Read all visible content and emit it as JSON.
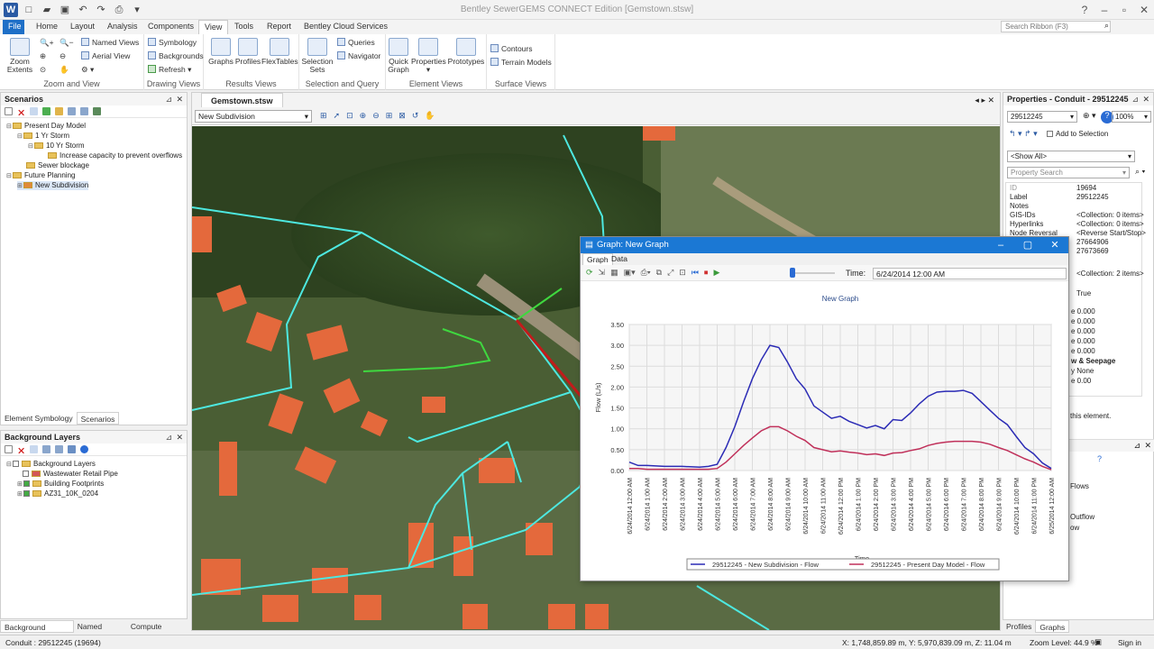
{
  "app": {
    "title": "Bentley SewerGEMS CONNECT Edition [Gemstown.stsw]",
    "search_ribbon_placeholder": "Search Ribbon (F3)"
  },
  "tabs": [
    "File",
    "Home",
    "Layout",
    "Analysis",
    "Components",
    "View",
    "Tools",
    "Report",
    "Bentley Cloud Services"
  ],
  "active_tab": "View",
  "ribbon": {
    "zoom_group": {
      "label": "Zoom and View",
      "zoom_extents": "Zoom Extents",
      "named_views": "Named Views",
      "aerial_view": "Aerial View"
    },
    "drawing_group": {
      "label": "Drawing Views",
      "symbology": "Symbology",
      "backgrounds": "Backgrounds",
      "refresh": "Refresh"
    },
    "results_group": {
      "label": "Results Views",
      "graphs": "Graphs",
      "profiles": "Profiles",
      "flextables": "FlexTables"
    },
    "selection_group": {
      "label": "Selection and Query",
      "selection_sets": "Selection Sets",
      "queries": "Queries",
      "navigator": "Navigator"
    },
    "element_group": {
      "label": "Element Views",
      "quick_graph": "Quick Graph",
      "properties": "Properties",
      "prototypes": "Prototypes"
    },
    "surface_group": {
      "label": "Surface Views",
      "contours": "Contours",
      "terrain_models": "Terrain Models"
    }
  },
  "scenarios_panel": {
    "title": "Scenarios",
    "items": [
      {
        "label": "Present Day Model",
        "level": 0
      },
      {
        "label": "1 Yr Storm",
        "level": 1
      },
      {
        "label": "10 Yr Storm",
        "level": 2
      },
      {
        "label": "Increase capacity to prevent overflows",
        "level": 3
      },
      {
        "label": "Sewer blockage",
        "level": 1
      },
      {
        "label": "Future Planning",
        "level": 0
      },
      {
        "label": "New Subdivision",
        "level": 1
      }
    ],
    "tabs": [
      "Element Symbology",
      "Scenarios"
    ]
  },
  "background_panel": {
    "title": "Background Layers",
    "items": [
      {
        "label": "Background Layers",
        "level": 0
      },
      {
        "label": "Wastewater Retail Pipe",
        "level": 1
      },
      {
        "label": "Building Footprints",
        "level": 1
      },
      {
        "label": "AZ31_10K_0204",
        "level": 1
      }
    ],
    "tabs": [
      "Background Layers",
      "Named Views",
      "Compute Center"
    ]
  },
  "document": {
    "tab": "Gemstown.stsw",
    "scenario": "New Subdivision"
  },
  "properties": {
    "title": "Properties - Conduit - 29512245",
    "element_select": "29512245",
    "zoom": "100%",
    "add_to_selection": "Add to Selection",
    "filter": "<Show All>",
    "search_placeholder": "Property Search",
    "rows": [
      {
        "k": "ID",
        "v": "19694"
      },
      {
        "k": "Label",
        "v": "29512245"
      },
      {
        "k": "Notes",
        "v": ""
      },
      {
        "k": "GIS-IDs",
        "v": "<Collection: 0 items>"
      },
      {
        "k": "Hyperlinks",
        "v": "<Collection: 0 items>"
      },
      {
        "k": "Node Reversal",
        "v": "<Reverse Start/Stop>"
      },
      {
        "k": "",
        "v": "27664906"
      },
      {
        "k": "",
        "v": "27673669"
      }
    ],
    "hidden_rows": [
      {
        "v": "<Collection: 2 items>"
      },
      {
        "v": "True"
      },
      {
        "v": "e 0.000"
      },
      {
        "v": "e 0.000"
      },
      {
        "v": "e 0.000"
      },
      {
        "v": "e 0.000"
      },
      {
        "v": "e 0.000"
      },
      {
        "v": "w & Seepage"
      },
      {
        "v": "y None"
      },
      {
        "v": "e 0.00"
      }
    ],
    "footer_text": "this element.",
    "side_items": [
      "Flows",
      "Outflow",
      "ow"
    ],
    "bottom_tabs": [
      "Profiles",
      "Graphs"
    ]
  },
  "graph_window": {
    "title": "Graph: New Graph",
    "tabs": [
      "Graph",
      "Data"
    ],
    "time_label": "Time:",
    "time_value": "6/24/2014 12:00 AM",
    "chart_title": "New Graph"
  },
  "chart_data": {
    "type": "line",
    "title": "New Graph",
    "xlabel": "Time",
    "ylabel": "Flow (L/s)",
    "ylim": [
      0,
      3.5
    ],
    "yticks": [
      "0.00",
      "0.50",
      "1.00",
      "1.50",
      "2.00",
      "2.50",
      "3.00",
      "3.50"
    ],
    "categories": [
      "6/24/2014 12:00 AM",
      "6/24/2014 1:00 AM",
      "6/24/2014 2:00 AM",
      "6/24/2014 3:00 AM",
      "6/24/2014 4:00 AM",
      "6/24/2014 5:00 AM",
      "6/24/2014 6:00 AM",
      "6/24/2014 7:00 AM",
      "6/24/2014 8:00 AM",
      "6/24/2014 9:00 AM",
      "6/24/2014 10:00 AM",
      "6/24/2014 11:00 AM",
      "6/24/2014 12:00 PM",
      "6/24/2014 1:00 PM",
      "6/24/2014 2:00 PM",
      "6/24/2014 3:00 PM",
      "6/24/2014 4:00 PM",
      "6/24/2014 5:00 PM",
      "6/24/2014 6:00 PM",
      "6/24/2014 7:00 PM",
      "6/24/2014 8:00 PM",
      "6/24/2014 9:00 PM",
      "6/24/2014 10:00 PM",
      "6/24/2014 11:00 PM",
      "6/25/2014 12:00 AM"
    ],
    "x_hours": [
      0,
      0.5,
      1,
      2,
      3,
      4,
      4.5,
      5,
      5.5,
      6,
      6.5,
      7,
      7.5,
      8,
      8.5,
      9,
      9.5,
      10,
      10.5,
      11,
      11.5,
      12,
      12.5,
      13,
      13.5,
      14,
      14.5,
      15,
      15.5,
      16,
      16.5,
      17,
      17.5,
      18,
      18.5,
      19,
      19.5,
      20,
      20.5,
      21,
      21.5,
      22,
      22.5,
      23,
      23.5,
      24
    ],
    "series": [
      {
        "name": "29512245 - New Subdivision - Flow",
        "color": "#2b2bb5",
        "values": [
          0.2,
          0.12,
          0.12,
          0.1,
          0.1,
          0.08,
          0.1,
          0.15,
          0.55,
          1.05,
          1.65,
          2.2,
          2.65,
          3.0,
          2.95,
          2.6,
          2.2,
          1.95,
          1.55,
          1.4,
          1.25,
          1.3,
          1.18,
          1.1,
          1.02,
          1.08,
          1.0,
          1.22,
          1.2,
          1.38,
          1.6,
          1.78,
          1.88,
          1.9,
          1.9,
          1.92,
          1.85,
          1.65,
          1.45,
          1.25,
          1.1,
          0.82,
          0.55,
          0.4,
          0.18,
          0.05
        ]
      },
      {
        "name": "29512245 - Present Day Model - Flow",
        "color": "#c0305a",
        "values": [
          0.05,
          0.05,
          0.03,
          0.03,
          0.03,
          0.03,
          0.03,
          0.05,
          0.2,
          0.4,
          0.6,
          0.78,
          0.95,
          1.05,
          1.05,
          0.95,
          0.82,
          0.72,
          0.55,
          0.5,
          0.45,
          0.47,
          0.44,
          0.42,
          0.38,
          0.4,
          0.36,
          0.42,
          0.43,
          0.48,
          0.52,
          0.6,
          0.65,
          0.68,
          0.7,
          0.7,
          0.7,
          0.68,
          0.63,
          0.55,
          0.48,
          0.38,
          0.28,
          0.2,
          0.1,
          0.02
        ]
      }
    ],
    "grid": true,
    "legend": "bottom"
  },
  "statusbar": {
    "left": "Conduit : 29512245 (19694)",
    "coords": "X: 1,748,859.89 m, Y: 5,970,839.09 m, Z: 11.04 m",
    "zoom": "Zoom Level: 44.9 %",
    "signin": "Sign in"
  }
}
